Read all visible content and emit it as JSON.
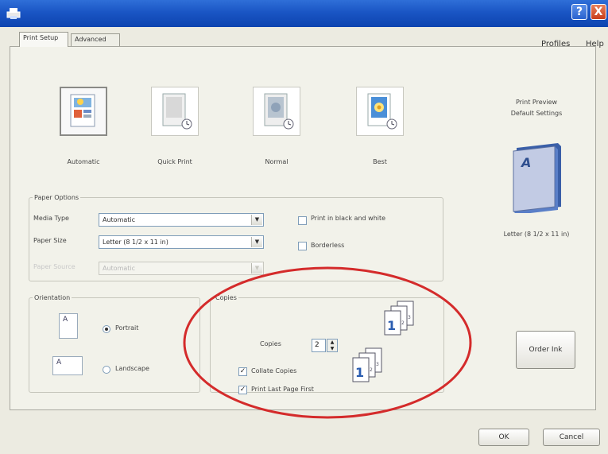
{
  "window": {
    "help_button": "?",
    "close_button": "X"
  },
  "menu": {
    "profiles": "Profiles",
    "help": "Help"
  },
  "tabs": [
    {
      "label": "Print Setup",
      "active": true
    },
    {
      "label": "Advanced",
      "active": false
    }
  ],
  "quality": {
    "selected": "Automatic",
    "options": [
      {
        "label": "Automatic",
        "icon": "automatic-quality-icon"
      },
      {
        "label": "Quick Print",
        "icon": "quick-print-icon"
      },
      {
        "label": "Normal",
        "icon": "normal-quality-icon"
      },
      {
        "label": "Best",
        "icon": "best-quality-icon"
      }
    ]
  },
  "paper_options": {
    "legend": "Paper Options",
    "media_type_label": "Media Type",
    "media_type_value": "Automatic",
    "paper_size_label": "Paper Size",
    "paper_size_value": "Letter (8 1/2 x 11 in)",
    "paper_source_label": "Paper Source",
    "paper_source_value": "Automatic",
    "black_white_label": "Print in black and white",
    "black_white_checked": false,
    "borderless_label": "Borderless",
    "borderless_checked": false
  },
  "orientation": {
    "legend": "Orientation",
    "portrait_label": "Portrait",
    "landscape_label": "Landscape",
    "portrait_icon_letter": "A",
    "landscape_icon_letter": "A",
    "selected": "Portrait"
  },
  "copies": {
    "legend": "Copies",
    "copies_label": "Copies",
    "copies_value": "2",
    "collate_label": "Collate Copies",
    "collate_checked": true,
    "last_page_first_label": "Print Last Page First",
    "last_page_first_checked": true
  },
  "preview": {
    "title": "Print Preview",
    "subtitle": "Default Settings",
    "page_letter": "A",
    "paper_size": "Letter (8 1/2 x 11 in)"
  },
  "buttons": {
    "order_ink": "Order Ink",
    "ok": "OK",
    "cancel": "Cancel"
  },
  "colors": {
    "titlebar": "#1a55c4",
    "annotation_ring": "#d42b2b",
    "page_icon": "#4a6fb5"
  }
}
